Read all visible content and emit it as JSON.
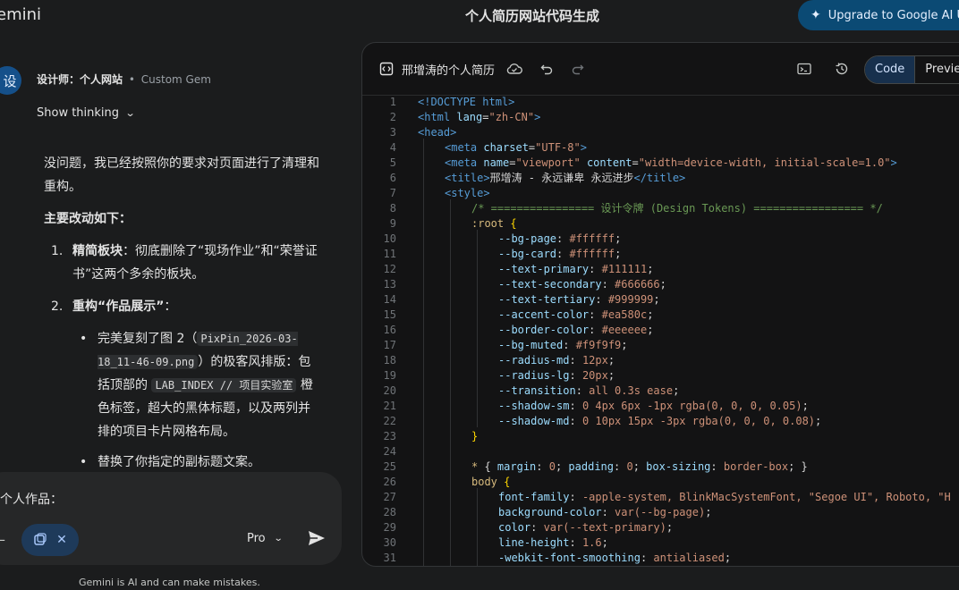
{
  "app": {
    "brand": "emini",
    "conversation_title": "个人简历网站代码生成",
    "upgrade_label": "Upgrade to Google AI Ult"
  },
  "chat": {
    "avatar_text": "设",
    "gem_name": "设计师：个人网站",
    "gem_separator": "•",
    "gem_tag": "Custom Gem",
    "show_thinking": "Show thinking",
    "intro": "没问题，我已经按照你的要求对页面进行了清理和重构。",
    "changes_heading": "主要改动如下：",
    "item1_num": "1.",
    "item1_title": "精简板块",
    "item1_text": "：彻底删除了“现场作业”和“荣誉证书”这两个多余的板块。",
    "item2_num": "2.",
    "item2_title": "重构“作品展示”",
    "item2_colon": "：",
    "bullet_dot": "•",
    "bullet1_pre": "完美复刻了图 2（",
    "bullet1_code": "PixPin_2026-03-18_11-46-09.png",
    "bullet1_mid": "）的极客风排版：包括顶部的 ",
    "bullet1_code2": "LAB_INDEX // 项目实验室",
    "bullet1_post": " 橙色标签，超大的黑体标题，以及两列并排的项目卡片网格布局。",
    "bullet2": "替换了你指定的副标题文案。",
    "faded_text": "一个人作品："
  },
  "input": {
    "text": "个人作品：",
    "model": "Pro",
    "disclaimer": "Gemini is AI and can make mistakes."
  },
  "canvas": {
    "doc_title": "邢增涛的个人简历",
    "tab_code": "Code",
    "tab_preview": "Preview",
    "line_numbers": [
      "1",
      "2",
      "3",
      "4",
      "5",
      "6",
      "7",
      "8",
      "9",
      "10",
      "11",
      "12",
      "13",
      "14",
      "15",
      "16",
      "17",
      "18",
      "19",
      "20",
      "21",
      "22",
      "23",
      "24",
      "25",
      "26",
      "27",
      "28",
      "29",
      "30",
      "31"
    ],
    "code": {
      "l1": [
        "<!DOCTYPE html>"
      ],
      "l2": [
        "<html",
        " lang",
        "=",
        "\"zh-CN\"",
        ">"
      ],
      "l3": [
        "<head>"
      ],
      "l4": [
        "<meta",
        " charset",
        "=",
        "\"UTF-8\"",
        ">"
      ],
      "l5": [
        "<meta",
        " name",
        "=",
        "\"viewport\"",
        " content",
        "=",
        "\"width=device-width, initial-scale=1.0\"",
        ">"
      ],
      "l6": [
        "<title>",
        "邢增涛 - 永远谦卑 永远进步",
        "</title>"
      ],
      "l7": [
        "<style>"
      ],
      "l8": [
        "/* ================ 设计令牌 (Design Tokens) ================= */"
      ],
      "l9": [
        ":root",
        " {"
      ],
      "vars": [
        [
          "--bg-page",
          "#ffffff"
        ],
        [
          "--bg-card",
          "#ffffff"
        ],
        [
          "--text-primary",
          "#111111"
        ],
        [
          "--text-secondary",
          "#666666"
        ],
        [
          "--text-tertiary",
          "#999999"
        ],
        [
          "--accent-color",
          "#ea580c"
        ],
        [
          "--border-color",
          "#eeeeee"
        ],
        [
          "--bg-muted",
          "#f9f9f9"
        ],
        [
          "--radius-md",
          "12px"
        ],
        [
          "--radius-lg",
          "20px"
        ],
        [
          "--transition",
          "all 0.3s ease"
        ],
        [
          "--shadow-sm",
          "0 4px 6px -1px rgba(0, 0, 0, 0.05)"
        ],
        [
          "--shadow-md",
          "0 10px 15px -3px rgba(0, 0, 0, 0.08)"
        ]
      ],
      "l23": [
        "}"
      ],
      "l25": [
        "*",
        " { ",
        "margin",
        ": ",
        "0",
        "; ",
        "padding",
        ": ",
        "0",
        "; ",
        "box-sizing",
        ": ",
        "border-box",
        "; }"
      ],
      "l26": [
        "body",
        " {"
      ],
      "l27": [
        "font-family",
        ": ",
        "-apple-system, BlinkMacSystemFont, \"Segoe UI\", Roboto, \"H",
        ""
      ],
      "l28": [
        "background-color",
        ": ",
        "var(--bg-page)",
        ";"
      ],
      "l29": [
        "color",
        ": ",
        "var(--text-primary)",
        ";"
      ],
      "l30": [
        "line-height",
        ": ",
        "1.6",
        ";"
      ],
      "l31": [
        "-webkit-font-smoothing",
        ": ",
        "antialiased",
        ";"
      ]
    }
  },
  "colors": {
    "background": "#1b1c1d",
    "canvas_bg": "#131314",
    "accent_blue": "#0b4a74",
    "code_tag": "#569cd6",
    "code_string": "#ce9178",
    "code_comment": "#6a9955"
  },
  "icons": {
    "upgrade": "sparkle-icon",
    "doc": "code-doc-icon",
    "cloud": "cloud-sync-icon",
    "undo": "undo-icon",
    "redo": "redo-icon",
    "console": "terminal-icon",
    "history": "history-icon",
    "send": "send-icon"
  }
}
